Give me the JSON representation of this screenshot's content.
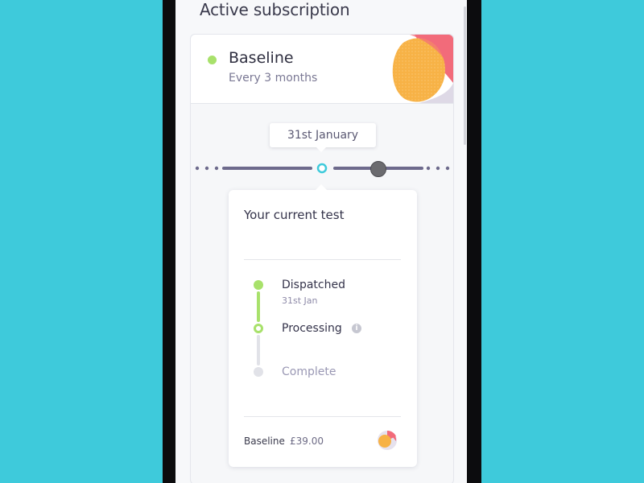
{
  "page": {
    "section_title": "Active subscription"
  },
  "subscription": {
    "plan_name": "Baseline",
    "frequency": "Every 3 months",
    "status_color": "#a8e16b",
    "art_icon": "baseline-plan-art-icon"
  },
  "timeline": {
    "selected_date": "31st January",
    "track_color": "#6d6a8c",
    "selected_color": "#3ecadb"
  },
  "current_test": {
    "title": "Your current test",
    "steps": [
      {
        "label": "Dispatched",
        "date": "31st Jan",
        "state": "done"
      },
      {
        "label": "Processing",
        "date": "",
        "state": "active",
        "info_icon": "info-icon"
      },
      {
        "label": "Complete",
        "date": "",
        "state": "pending"
      }
    ],
    "footer": {
      "plan_name": "Baseline",
      "price": "£39.00",
      "icon": "baseline-plan-icon"
    }
  },
  "colors": {
    "background": "#3ecadb",
    "accent_green": "#a8e16b",
    "pending_grey": "#e1e2e8"
  }
}
